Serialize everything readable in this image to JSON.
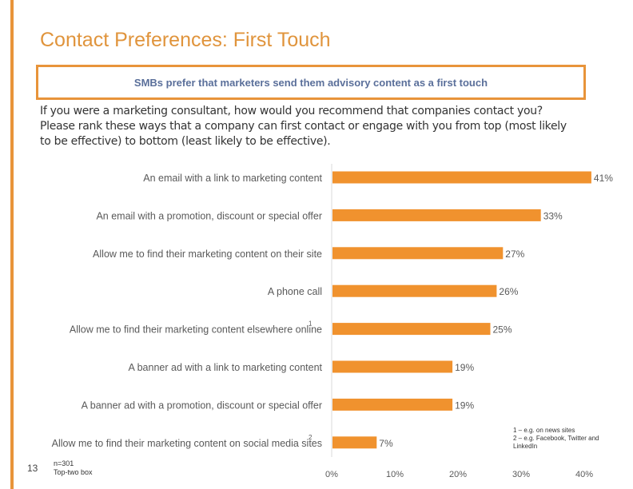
{
  "title": "Contact Preferences: First Touch",
  "callout": "SMBs prefer that marketers send them advisory content as a first touch",
  "question": "If you were a marketing consultant, how would you recommend that companies contact you? Please rank these ways that a company can first contact or engage with you from top (most likely to be effective) to bottom (least likely to be effective).",
  "page_number": "13",
  "sample": "n=301",
  "measure": "Top-two box",
  "footnotes": [
    "1 – e.g. on news sites",
    "2 – e.g. Facebook, Twitter and LinkedIn"
  ],
  "colors": {
    "accent": "#e8943a",
    "bar": "#f0922e",
    "callout_text": "#5a6f9a"
  },
  "chart_data": {
    "type": "bar",
    "orientation": "horizontal",
    "categories": [
      "An email with a link to marketing content",
      "An email with a promotion, discount or special offer",
      "Allow me to find their marketing content on their site",
      "A phone call",
      "Allow me to find their marketing content elsewhere online",
      "A banner ad with a link to marketing content",
      "A banner ad with a promotion, discount or special offer",
      "Allow me to find their marketing content on social media sites"
    ],
    "superscripts": [
      "",
      "",
      "",
      "",
      "1",
      "",
      "",
      "2"
    ],
    "values": [
      41,
      33,
      27,
      26,
      25,
      19,
      19,
      7
    ],
    "data_labels": [
      "41%",
      "33%",
      "27%",
      "26%",
      "25%",
      "19%",
      "19%",
      "7%"
    ],
    "xlim": [
      0,
      40
    ],
    "xticks": [
      "0%",
      "10%",
      "20%",
      "30%",
      "40%"
    ],
    "grid": false
  }
}
